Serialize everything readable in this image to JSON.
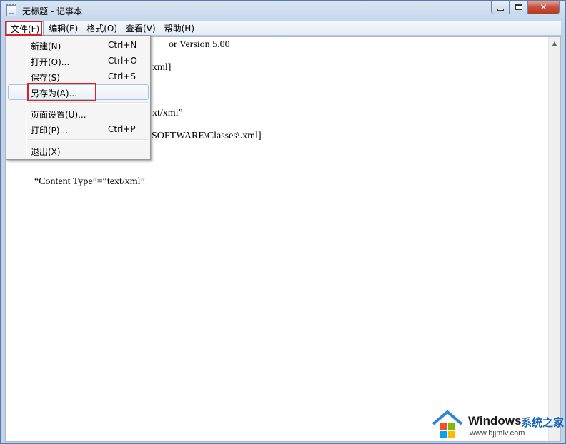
{
  "window": {
    "title": "无标题 - 记事本",
    "min_label": "",
    "max_label": "",
    "close_label": "✕"
  },
  "menubar": {
    "items": [
      {
        "label": "文件(F)"
      },
      {
        "label": "编辑(E)"
      },
      {
        "label": "格式(O)"
      },
      {
        "label": "查看(V)"
      },
      {
        "label": "帮助(H)"
      }
    ]
  },
  "file_menu": {
    "items": [
      {
        "label": "新建(N)",
        "shortcut": "Ctrl+N"
      },
      {
        "label": "打开(O)...",
        "shortcut": "Ctrl+O"
      },
      {
        "label": "保存(S)",
        "shortcut": "Ctrl+S"
      },
      {
        "label": "另存为(A)...",
        "shortcut": ""
      },
      {
        "label": "页面设置(U)...",
        "shortcut": ""
      },
      {
        "label": "打印(P)...",
        "shortcut": "Ctrl+P"
      },
      {
        "label": "退出(X)",
        "shortcut": ""
      }
    ]
  },
  "editor": {
    "visible_lines": [
      "or Version 5.00",
      "xml]",
      "xt/xml”",
      "SOFTWARE\\Classes\\.xml]",
      "“Content Type”=“text/xml”"
    ]
  },
  "scrollbar": {
    "up_arrow": "▲"
  },
  "watermark": {
    "brand": "Windows",
    "site_name": "系统之家",
    "url": "www.bjjmlv.com"
  },
  "colors": {
    "highlight_box": "#e02020",
    "menu_hover": "#ebf1f9"
  }
}
